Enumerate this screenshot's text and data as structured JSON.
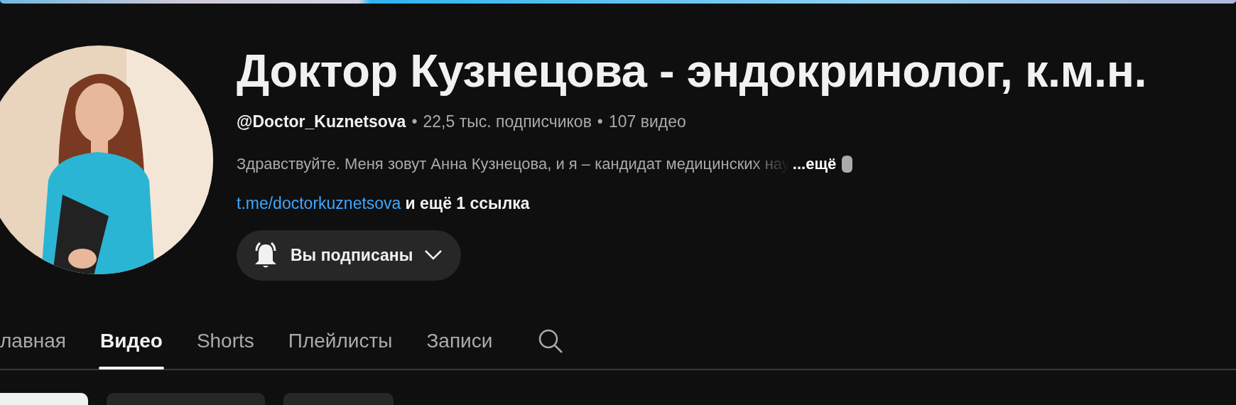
{
  "channel": {
    "title": "Доктор Кузнецова - эндокринолог, к.м.н.",
    "handle": "@Doctor_Kuznetsova",
    "separator": "•",
    "meta": [
      "22,5 тыс. подписчиков",
      "107 видео"
    ],
    "description": "Здравствуйте. Меня зовут Анна Кузнецова, и я – кандидат медицинских нау",
    "more": "...ещё",
    "link": "t.me/doctorkuznetsova",
    "more_links": "и ещё 1 ссылка",
    "subscribe": {
      "label": "Вы подписаны",
      "subscribed": true
    }
  },
  "tabs": [
    {
      "label": "лавная",
      "selected": false
    },
    {
      "label": "Видео",
      "selected": true
    },
    {
      "label": "Shorts",
      "selected": false
    },
    {
      "label": "Плейлисты",
      "selected": false
    },
    {
      "label": "Записи",
      "selected": false
    }
  ],
  "chips": [
    {
      "selected": true
    },
    {
      "selected": false
    },
    {
      "selected": false
    }
  ]
}
